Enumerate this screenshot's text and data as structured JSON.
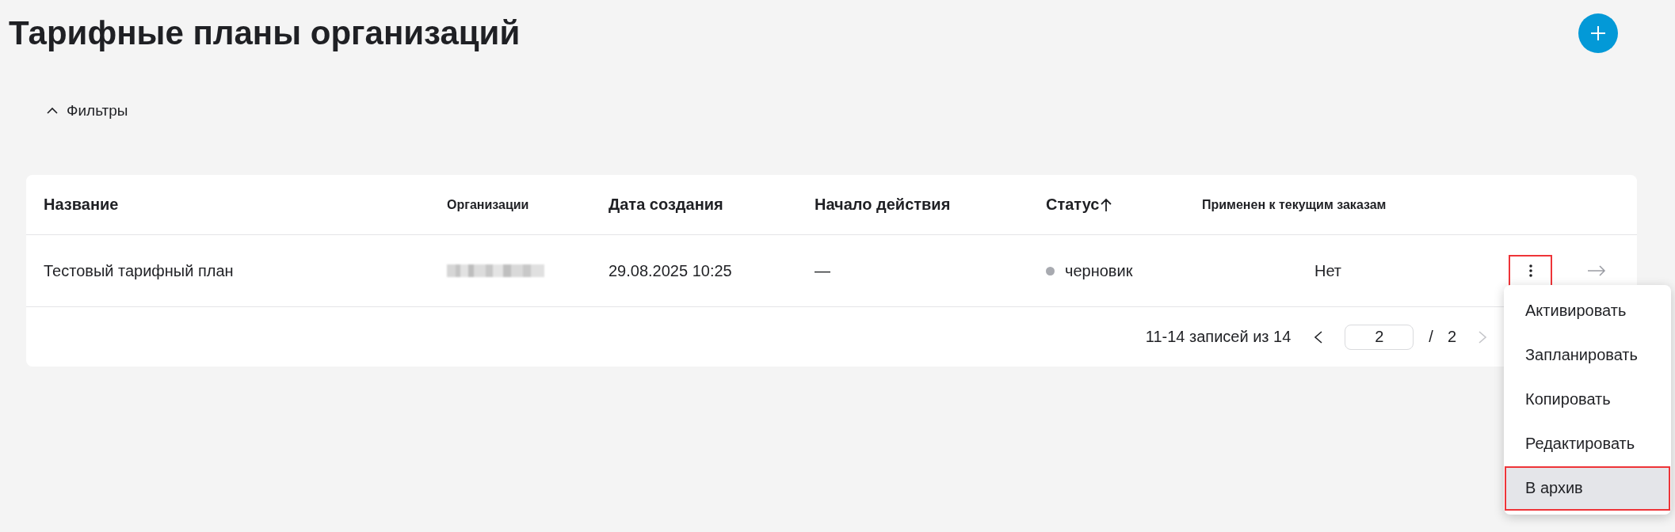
{
  "page": {
    "title": "Тарифные планы организаций"
  },
  "filters": {
    "label": "Фильтры",
    "expanded": true
  },
  "table": {
    "columns": [
      {
        "label": "Название",
        "sorted": false
      },
      {
        "label": "Организации",
        "sorted": false
      },
      {
        "label": "Дата создания",
        "sorted": false
      },
      {
        "label": "Начало действия",
        "sorted": false
      },
      {
        "label": "Статус",
        "sorted": true
      },
      {
        "label": "Применен к текущим заказам",
        "sorted": false
      }
    ],
    "rows": [
      {
        "name": "Тестовый тарифный план",
        "organization": {
          "kind": "redacted"
        },
        "created": "29.08.2025 10:25",
        "start": "—",
        "status": {
          "label": "черновик",
          "color": "#a8aab0"
        },
        "applied": "Нет",
        "menu": {
          "open": true,
          "button_annotated": true,
          "items": [
            {
              "label": "Активировать",
              "selected": false,
              "annotated": false
            },
            {
              "label": "Запланировать",
              "selected": false,
              "annotated": false
            },
            {
              "label": "Копировать",
              "selected": false,
              "annotated": false
            },
            {
              "label": "Редактировать",
              "selected": false,
              "annotated": false
            },
            {
              "label": "В архив",
              "selected": true,
              "annotated": true
            }
          ]
        }
      }
    ]
  },
  "pagination": {
    "summary": "11-14 записей из 14",
    "page": "2",
    "separator": "/",
    "total": "2",
    "prev_disabled": false,
    "next_disabled": true
  }
}
